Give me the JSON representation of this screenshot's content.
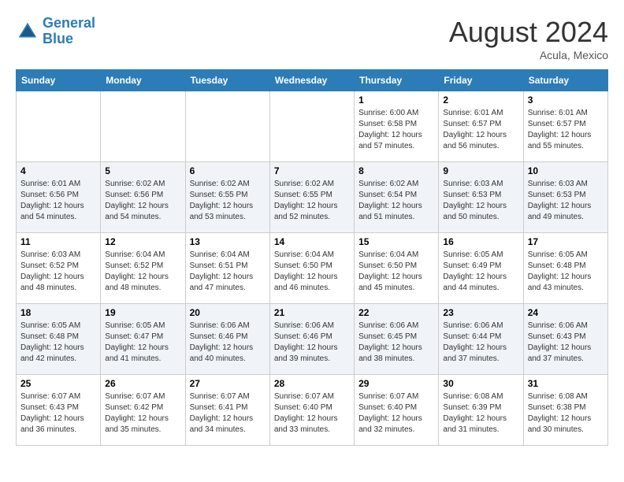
{
  "header": {
    "logo_line1": "General",
    "logo_line2": "Blue",
    "month": "August 2024",
    "location": "Acula, Mexico"
  },
  "days_of_week": [
    "Sunday",
    "Monday",
    "Tuesday",
    "Wednesday",
    "Thursday",
    "Friday",
    "Saturday"
  ],
  "weeks": [
    [
      {
        "day": "",
        "info": ""
      },
      {
        "day": "",
        "info": ""
      },
      {
        "day": "",
        "info": ""
      },
      {
        "day": "",
        "info": ""
      },
      {
        "day": "1",
        "info": "Sunrise: 6:00 AM\nSunset: 6:58 PM\nDaylight: 12 hours\nand 57 minutes."
      },
      {
        "day": "2",
        "info": "Sunrise: 6:01 AM\nSunset: 6:57 PM\nDaylight: 12 hours\nand 56 minutes."
      },
      {
        "day": "3",
        "info": "Sunrise: 6:01 AM\nSunset: 6:57 PM\nDaylight: 12 hours\nand 55 minutes."
      }
    ],
    [
      {
        "day": "4",
        "info": "Sunrise: 6:01 AM\nSunset: 6:56 PM\nDaylight: 12 hours\nand 54 minutes."
      },
      {
        "day": "5",
        "info": "Sunrise: 6:02 AM\nSunset: 6:56 PM\nDaylight: 12 hours\nand 54 minutes."
      },
      {
        "day": "6",
        "info": "Sunrise: 6:02 AM\nSunset: 6:55 PM\nDaylight: 12 hours\nand 53 minutes."
      },
      {
        "day": "7",
        "info": "Sunrise: 6:02 AM\nSunset: 6:55 PM\nDaylight: 12 hours\nand 52 minutes."
      },
      {
        "day": "8",
        "info": "Sunrise: 6:02 AM\nSunset: 6:54 PM\nDaylight: 12 hours\nand 51 minutes."
      },
      {
        "day": "9",
        "info": "Sunrise: 6:03 AM\nSunset: 6:53 PM\nDaylight: 12 hours\nand 50 minutes."
      },
      {
        "day": "10",
        "info": "Sunrise: 6:03 AM\nSunset: 6:53 PM\nDaylight: 12 hours\nand 49 minutes."
      }
    ],
    [
      {
        "day": "11",
        "info": "Sunrise: 6:03 AM\nSunset: 6:52 PM\nDaylight: 12 hours\nand 48 minutes."
      },
      {
        "day": "12",
        "info": "Sunrise: 6:04 AM\nSunset: 6:52 PM\nDaylight: 12 hours\nand 48 minutes."
      },
      {
        "day": "13",
        "info": "Sunrise: 6:04 AM\nSunset: 6:51 PM\nDaylight: 12 hours\nand 47 minutes."
      },
      {
        "day": "14",
        "info": "Sunrise: 6:04 AM\nSunset: 6:50 PM\nDaylight: 12 hours\nand 46 minutes."
      },
      {
        "day": "15",
        "info": "Sunrise: 6:04 AM\nSunset: 6:50 PM\nDaylight: 12 hours\nand 45 minutes."
      },
      {
        "day": "16",
        "info": "Sunrise: 6:05 AM\nSunset: 6:49 PM\nDaylight: 12 hours\nand 44 minutes."
      },
      {
        "day": "17",
        "info": "Sunrise: 6:05 AM\nSunset: 6:48 PM\nDaylight: 12 hours\nand 43 minutes."
      }
    ],
    [
      {
        "day": "18",
        "info": "Sunrise: 6:05 AM\nSunset: 6:48 PM\nDaylight: 12 hours\nand 42 minutes."
      },
      {
        "day": "19",
        "info": "Sunrise: 6:05 AM\nSunset: 6:47 PM\nDaylight: 12 hours\nand 41 minutes."
      },
      {
        "day": "20",
        "info": "Sunrise: 6:06 AM\nSunset: 6:46 PM\nDaylight: 12 hours\nand 40 minutes."
      },
      {
        "day": "21",
        "info": "Sunrise: 6:06 AM\nSunset: 6:46 PM\nDaylight: 12 hours\nand 39 minutes."
      },
      {
        "day": "22",
        "info": "Sunrise: 6:06 AM\nSunset: 6:45 PM\nDaylight: 12 hours\nand 38 minutes."
      },
      {
        "day": "23",
        "info": "Sunrise: 6:06 AM\nSunset: 6:44 PM\nDaylight: 12 hours\nand 37 minutes."
      },
      {
        "day": "24",
        "info": "Sunrise: 6:06 AM\nSunset: 6:43 PM\nDaylight: 12 hours\nand 37 minutes."
      }
    ],
    [
      {
        "day": "25",
        "info": "Sunrise: 6:07 AM\nSunset: 6:43 PM\nDaylight: 12 hours\nand 36 minutes."
      },
      {
        "day": "26",
        "info": "Sunrise: 6:07 AM\nSunset: 6:42 PM\nDaylight: 12 hours\nand 35 minutes."
      },
      {
        "day": "27",
        "info": "Sunrise: 6:07 AM\nSunset: 6:41 PM\nDaylight: 12 hours\nand 34 minutes."
      },
      {
        "day": "28",
        "info": "Sunrise: 6:07 AM\nSunset: 6:40 PM\nDaylight: 12 hours\nand 33 minutes."
      },
      {
        "day": "29",
        "info": "Sunrise: 6:07 AM\nSunset: 6:40 PM\nDaylight: 12 hours\nand 32 minutes."
      },
      {
        "day": "30",
        "info": "Sunrise: 6:08 AM\nSunset: 6:39 PM\nDaylight: 12 hours\nand 31 minutes."
      },
      {
        "day": "31",
        "info": "Sunrise: 6:08 AM\nSunset: 6:38 PM\nDaylight: 12 hours\nand 30 minutes."
      }
    ]
  ]
}
